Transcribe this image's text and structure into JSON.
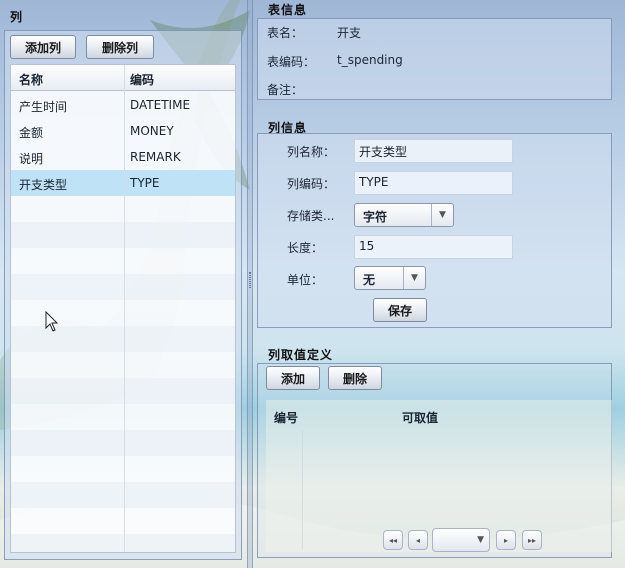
{
  "left": {
    "title": "列",
    "add_column": "添加列",
    "delete_column": "删除列",
    "headers": [
      "名称",
      "编码"
    ],
    "rows": [
      {
        "name": "产生时间",
        "code": "DATETIME"
      },
      {
        "name": "金额",
        "code": "MONEY"
      },
      {
        "name": "说明",
        "code": "REMARK"
      },
      {
        "name": "开支类型",
        "code": "TYPE"
      }
    ],
    "selected_row": 3
  },
  "table_info": {
    "title": "表信息",
    "name_label": "表名：",
    "name_value": "开支",
    "code_label": "表编码：",
    "code_value": "t_spending",
    "remark_label": "备注："
  },
  "column_info": {
    "title": "列信息",
    "name_label": "列名称：",
    "name_value": "开支类型",
    "code_label": "列编码：",
    "code_value": "TYPE",
    "storage_label": "存储类...",
    "storage_value": "字符",
    "length_label": "长度：",
    "length_value": "15",
    "unit_label": "单位：",
    "unit_value": "无",
    "save": "保存"
  },
  "value_def": {
    "title": "列取值定义",
    "add": "添加",
    "delete": "删除",
    "headers": [
      "编号",
      "可取值"
    ]
  },
  "icons": {
    "dropdown": "chevron-down-icon",
    "pager": [
      "first-page-icon",
      "prev-page-icon",
      "next-page-icon",
      "last-page-icon"
    ]
  }
}
